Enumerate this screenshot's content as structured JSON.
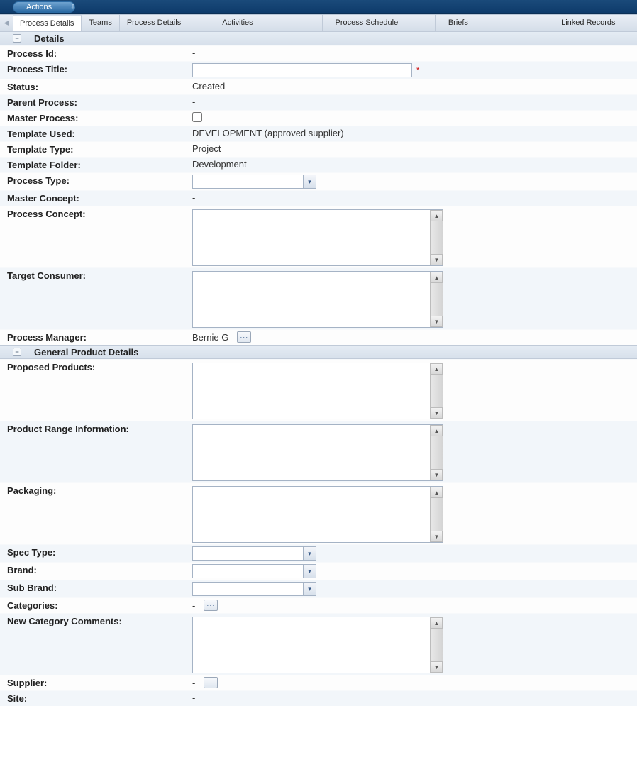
{
  "topbar": {
    "actions_label": "Actions"
  },
  "tabs": [
    {
      "label": "Process Details",
      "active": true
    },
    {
      "label": "Teams"
    },
    {
      "label": "Process Details"
    },
    {
      "label": "Activities"
    },
    {
      "label": "Process Schedule"
    },
    {
      "label": "Briefs"
    },
    {
      "label": "Linked Records"
    }
  ],
  "sections": {
    "details_title": "Details",
    "general_product_title": "General Product Details"
  },
  "details": {
    "process_id_label": "Process Id:",
    "process_id_value": "-",
    "process_title_label": "Process Title:",
    "process_title_value": "",
    "status_label": "Status:",
    "status_value": "Created",
    "parent_process_label": "Parent Process:",
    "parent_process_value": "-",
    "master_process_label": "Master Process:",
    "master_process_checked": false,
    "template_used_label": "Template Used:",
    "template_used_value": "DEVELOPMENT (approved supplier)",
    "template_type_label": "Template Type:",
    "template_type_value": "Project",
    "template_folder_label": "Template Folder:",
    "template_folder_value": "Development",
    "process_type_label": "Process Type:",
    "process_type_value": "",
    "master_concept_label": "Master Concept:",
    "master_concept_value": "-",
    "process_concept_label": "Process Concept:",
    "process_concept_value": "",
    "target_consumer_label": "Target Consumer:",
    "target_consumer_value": "",
    "process_manager_label": "Process Manager:",
    "process_manager_value": "Bernie G"
  },
  "general": {
    "proposed_products_label": "Proposed Products:",
    "proposed_products_value": "",
    "product_range_info_label": "Product Range Information:",
    "product_range_info_value": "",
    "packaging_label": "Packaging:",
    "packaging_value": "",
    "spec_type_label": "Spec Type:",
    "spec_type_value": "",
    "brand_label": "Brand:",
    "brand_value": "",
    "sub_brand_label": "Sub Brand:",
    "sub_brand_value": "",
    "categories_label": "Categories:",
    "categories_value": "-",
    "new_category_comments_label": "New Category Comments:",
    "new_category_comments_value": "",
    "supplier_label": "Supplier:",
    "supplier_value": "-",
    "site_label": "Site:",
    "site_value": "-"
  }
}
